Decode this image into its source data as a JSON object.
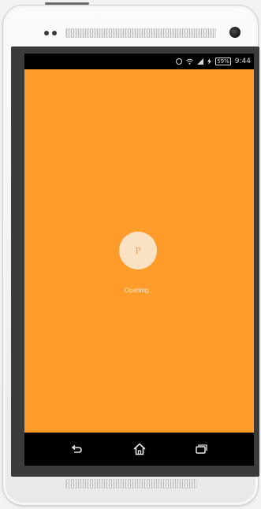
{
  "status_bar": {
    "battery_label": "59%",
    "time": "9:44",
    "icons": [
      "alarm-icon",
      "wifi-icon",
      "signal-icon",
      "charging-icon",
      "battery-icon"
    ]
  },
  "splash": {
    "logo_letter": "P",
    "loading_text": "Opening..."
  },
  "nav_bar": {
    "icons": [
      "back-icon",
      "home-icon",
      "recent-apps-icon"
    ]
  },
  "colors": {
    "app_background": "#ff9b2a",
    "logo_circle": "#fce2c5",
    "system_bars": "#000000"
  }
}
